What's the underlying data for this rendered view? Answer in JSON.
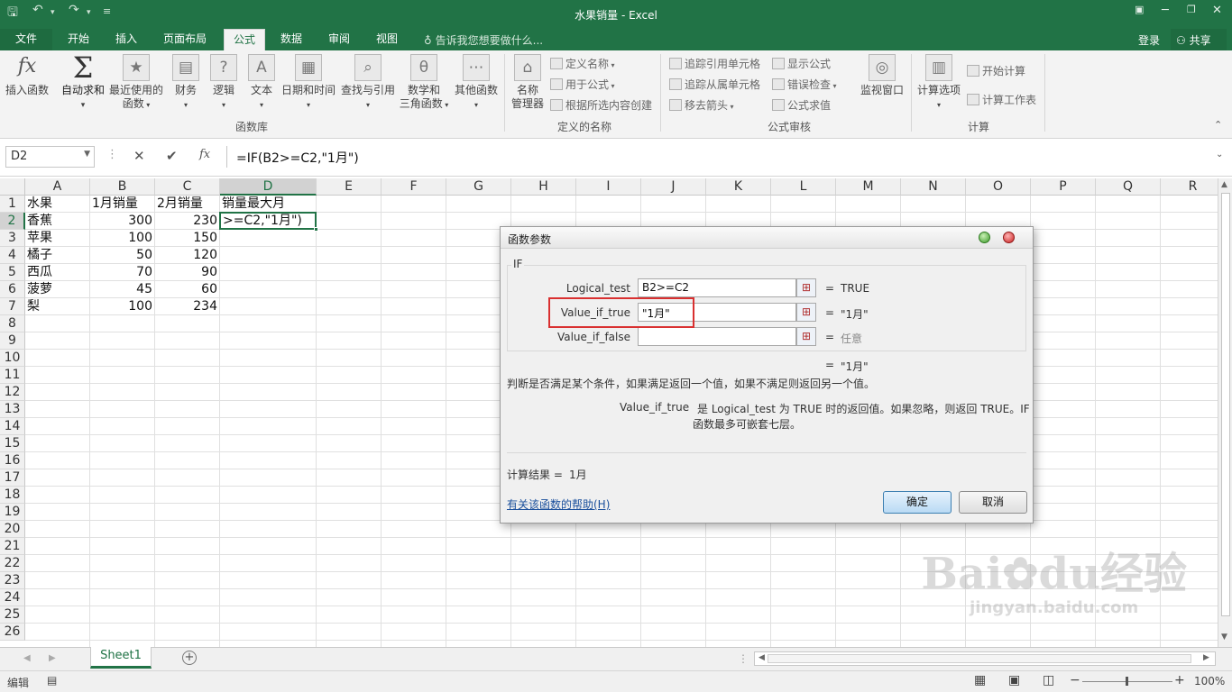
{
  "window": {
    "title": "水果销量 - Excel"
  },
  "tabs": [
    {
      "label": "文件"
    },
    {
      "label": "开始"
    },
    {
      "label": "插入"
    },
    {
      "label": "页面布局"
    },
    {
      "label": "公式"
    },
    {
      "label": "数据"
    },
    {
      "label": "审阅"
    },
    {
      "label": "视图"
    }
  ],
  "tell_me": "告诉我您想要做什么...",
  "account": {
    "login": "登录",
    "share": "共享"
  },
  "ribbon": {
    "function_library": {
      "label": "函数库",
      "insert_function": "插入函数",
      "autosum": "自动求和",
      "recent_l1": "最近使用的",
      "recent_l2": "函数",
      "financial": "财务",
      "logical": "逻辑",
      "text": "文本",
      "datetime": "日期和时间",
      "lookup": "查找与引用",
      "math_l1": "数学和",
      "math_l2": "三角函数",
      "more": "其他函数"
    },
    "defined_names": {
      "label": "定义的名称",
      "name_manager_l1": "名称",
      "name_manager_l2": "管理器",
      "define_name": "定义名称",
      "use_in_formula": "用于公式",
      "create_from_selection": "根据所选内容创建"
    },
    "formula_auditing": {
      "label": "公式审核",
      "trace_precedents": "追踪引用单元格",
      "trace_dependents": "追踪从属单元格",
      "remove_arrows": "移去箭头",
      "show_formulas": "显示公式",
      "error_checking": "错误检查",
      "evaluate_formula": "公式求值",
      "watch_window": "监视窗口"
    },
    "calculation": {
      "label": "计算",
      "options": "计算选项",
      "calc_now": "开始计算",
      "calc_sheet": "计算工作表"
    }
  },
  "formula_bar": {
    "name_box": "D2",
    "formula": "=IF(B2>=C2,\"1月\")",
    "fx": "fx"
  },
  "grid": {
    "columns": [
      "A",
      "B",
      "C",
      "D",
      "E",
      "F",
      "G",
      "H",
      "I",
      "J",
      "K",
      "L",
      "M",
      "N",
      "O",
      "P",
      "Q",
      "R"
    ],
    "rows": [
      "1",
      "2",
      "3",
      "4",
      "5",
      "6",
      "7",
      "8",
      "9",
      "10",
      "11",
      "12",
      "13",
      "14",
      "15",
      "16",
      "17",
      "18",
      "19",
      "20",
      "21",
      "22",
      "23",
      "24",
      "25",
      "26"
    ],
    "headers": [
      "水果",
      "1月销量",
      "2月销量",
      "销量最大月"
    ],
    "data": [
      {
        "fruit": "香蕉",
        "jan": "300",
        "feb": "230"
      },
      {
        "fruit": "苹果",
        "jan": "100",
        "feb": "150"
      },
      {
        "fruit": "橘子",
        "jan": "50",
        "feb": "120"
      },
      {
        "fruit": "西瓜",
        "jan": "70",
        "feb": "90"
      },
      {
        "fruit": "菠萝",
        "jan": "45",
        "feb": "60"
      },
      {
        "fruit": "梨",
        "jan": "100",
        "feb": "234"
      }
    ],
    "editing_cell_text": ">=C2,\"1月\")"
  },
  "dialog": {
    "title": "函数参数",
    "function_name": "IF",
    "args": [
      {
        "label": "Logical_test",
        "value": "B2>=C2",
        "result": "TRUE"
      },
      {
        "label": "Value_if_true",
        "value": "\"1月\"",
        "result": "\"1月\""
      },
      {
        "label": "Value_if_false",
        "value": "",
        "result": "任意"
      }
    ],
    "eq": "=",
    "overall_result": "\"1月\"",
    "description": "判断是否满足某个条件，如果满足返回一个值，如果不满足则返回另一个值。",
    "arg_help_name": "Value_if_true",
    "arg_help_l1": "是 Logical_test 为 TRUE 时的返回值。如果忽略，则返回 TRUE。IF",
    "arg_help_l2": "函数最多可嵌套七层。",
    "calc_result_label": "计算结果 =",
    "calc_result_value": "1月",
    "help_link": "有关该函数的帮助(H)",
    "ok": "确定",
    "cancel": "取消"
  },
  "sheet_tabs": [
    {
      "label": "Sheet1"
    }
  ],
  "status": {
    "mode": "编辑",
    "zoom": "100%"
  },
  "watermark": {
    "brand": "Bai",
    "brand2": "du",
    "suffix": "经验",
    "url": "jingyan.baidu.com"
  }
}
